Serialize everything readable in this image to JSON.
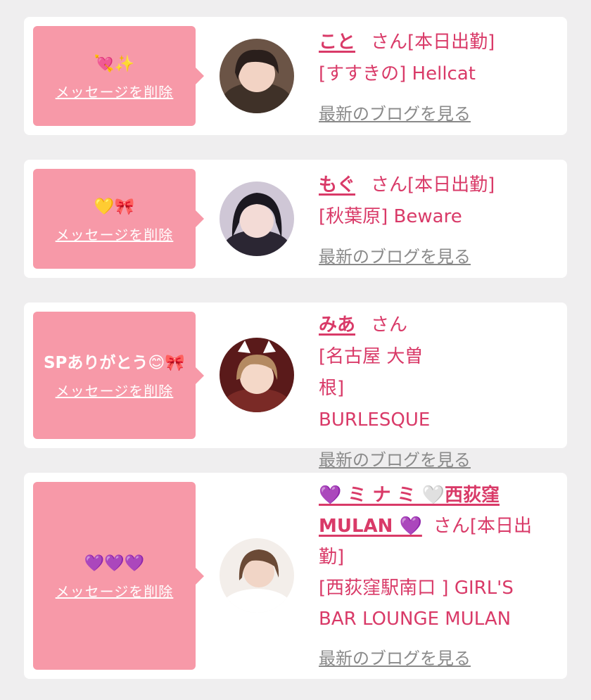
{
  "delete_label": "メッセージを削除",
  "blog_label": "最新のブログを見る",
  "colors": {
    "accent": "#d93a68",
    "bubble": "#f799a8",
    "background": "#efeeef"
  },
  "cards": [
    {
      "message": "💘✨",
      "name": "こと",
      "honorific": "さん[本日出勤]",
      "shop": "[すすきの] Hellcat"
    },
    {
      "message": "💛🎀",
      "name": "もぐ",
      "honorific": "さん[本日出勤]",
      "shop": "[秋葉原] Beware"
    },
    {
      "message": "SPありがとう😊🎀",
      "name": "みあ",
      "honorific": "さん",
      "shop": "[名古屋 大曽根] BURLESQUE"
    },
    {
      "message": "💜💜💜",
      "name": "💜 ミ ナ ミ 🤍西荻窪 MULAN 💜",
      "honorific": "さん[本日出勤]",
      "shop": "[西荻窪駅南口 ] GIRL'S BAR LOUNGE MULAN"
    }
  ]
}
